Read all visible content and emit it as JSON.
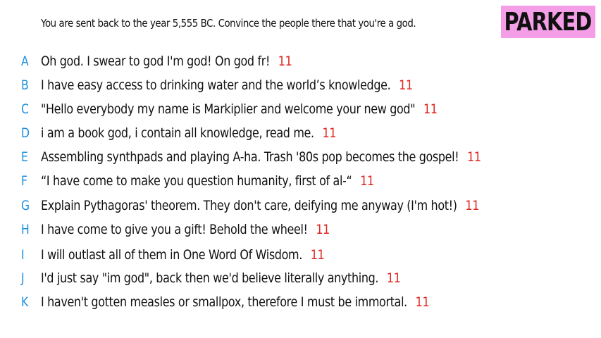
{
  "prompt": "You are sent back to the year 5,555 BC. Convince the people there that you're a god.",
  "status_badge": "PARKED",
  "colors": {
    "letter": "#1a8fe0",
    "votes": "#e0241c",
    "badge_bg": "#f49ee8",
    "text": "#111111"
  },
  "answers": [
    {
      "letter": "A",
      "text": "Oh god. I swear to god I'm god! On god fr!",
      "votes": "11"
    },
    {
      "letter": "B",
      "text": "I have easy access to drinking water and the world’s knowledge.",
      "votes": "11"
    },
    {
      "letter": "C",
      "text": "\"Hello everybody my name is Markiplier and welcome your new god\"",
      "votes": "11"
    },
    {
      "letter": "D",
      "text": "i am a book god, i contain all knowledge, read me.",
      "votes": "11"
    },
    {
      "letter": "E",
      "text": "Assembling synthpads and playing A-ha. Trash '80s pop becomes the gospel!",
      "votes": "11"
    },
    {
      "letter": "F",
      "text": "“I have come to make you question humanity, first of al-“",
      "votes": "11"
    },
    {
      "letter": "G",
      "text": "Explain Pythagoras' theorem. They don't care, deifying me anyway (I'm hot!)",
      "votes": "11"
    },
    {
      "letter": "H",
      "text": "I have come to give you a gift! Behold the wheel!",
      "votes": "11"
    },
    {
      "letter": "I",
      "text": "I will outlast all of them in One Word Of Wisdom.",
      "votes": "11"
    },
    {
      "letter": "J",
      "text": "I'd just say \"im god\", back then we'd believe literally anything.",
      "votes": "11"
    },
    {
      "letter": "K",
      "text": "I haven't gotten measles or smallpox, therefore I must be immortal.",
      "votes": "11"
    }
  ]
}
